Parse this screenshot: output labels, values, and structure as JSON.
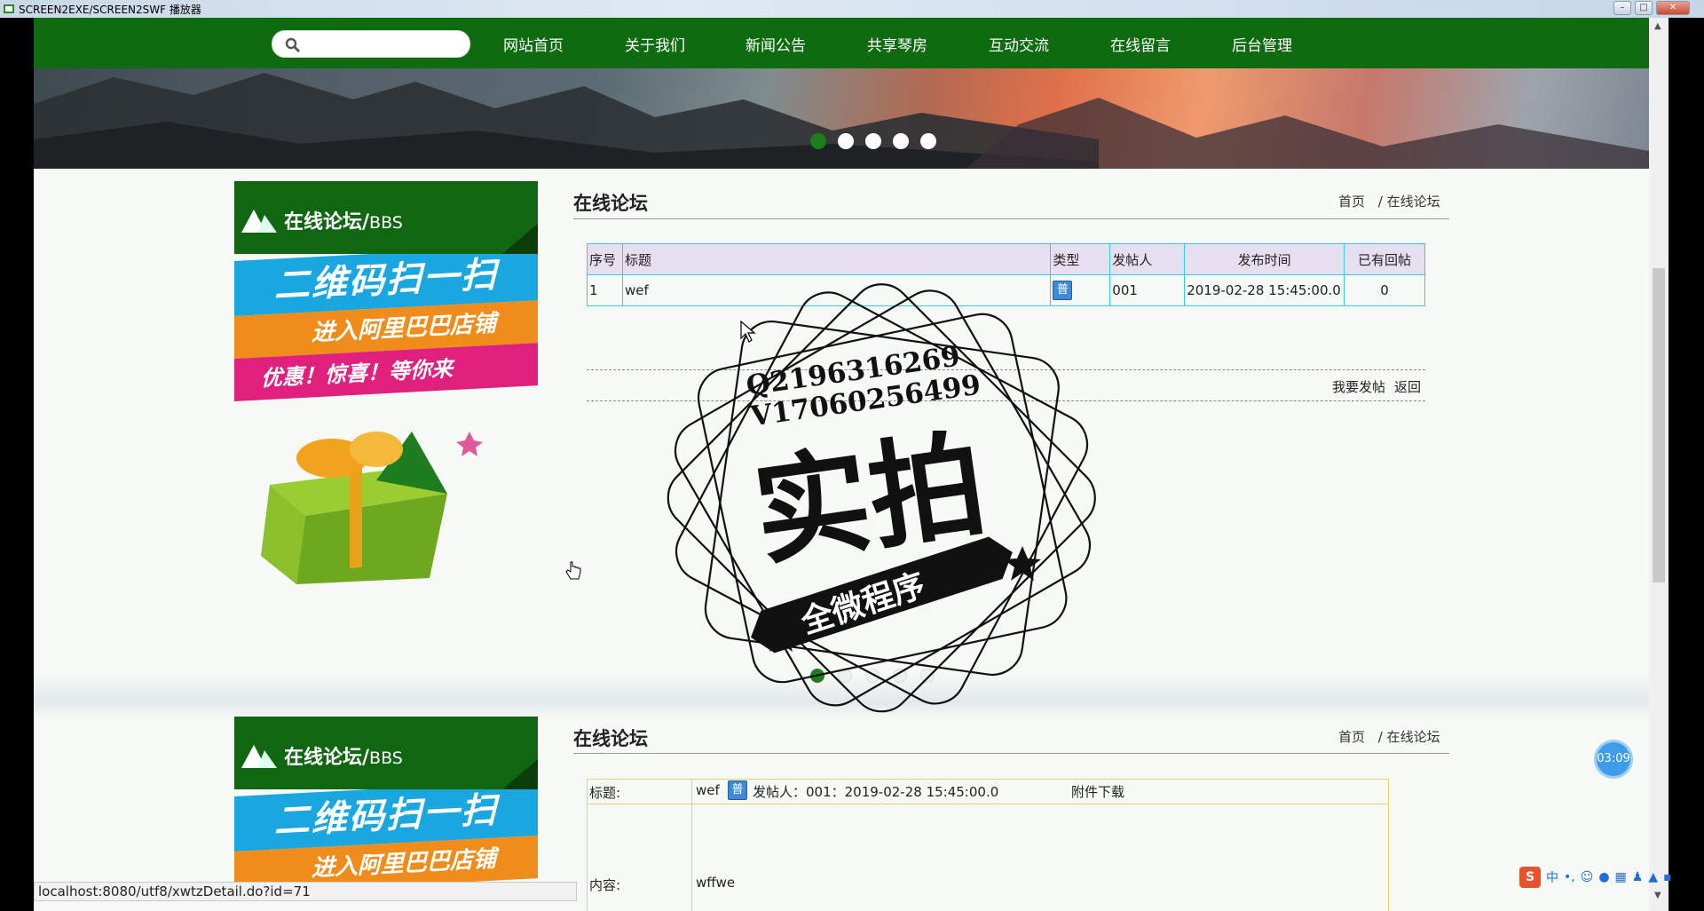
{
  "window": {
    "title": "SCREEN2EXE/SCREEN2SWF 播放器",
    "min": "–",
    "max": "□",
    "close": "✕"
  },
  "nav": {
    "search_placeholder": "",
    "items": [
      "网站首页",
      "关于我们",
      "新闻公告",
      "共享琴房",
      "互动交流",
      "在线留言",
      "后台管理"
    ]
  },
  "slider": {
    "dot_count": 5,
    "active_index": 0
  },
  "sidebar": {
    "title": "在线论坛/",
    "title_en": "BBS",
    "ad_line1": "二维码扫一扫",
    "ad_line2": "进入阿里巴巴店铺",
    "ad_line3": "优惠！惊喜！等你来"
  },
  "section1": {
    "title": "在线论坛",
    "crumb_home": "首页",
    "crumb_sep": "/",
    "crumb_current": "在线论坛",
    "table": {
      "headers": [
        "序号",
        "标题",
        "类型",
        "发帖人",
        "发布时间",
        "已有回帖"
      ],
      "rows": [
        {
          "index": "1",
          "title": "wef",
          "type": "普",
          "author": "001",
          "time": "2019-02-28 15:45:00.0",
          "replies": "0"
        }
      ]
    },
    "post_link": "我要发帖",
    "back_link": "返回"
  },
  "section2": {
    "title": "在线论坛",
    "crumb_home": "首页",
    "crumb_sep": "/",
    "crumb_current": "在线论坛",
    "detail": {
      "label_title": "标题:",
      "title_value": "wef",
      "type": "普",
      "author_text": "发帖人：001：2019-02-28 15:45:00.0",
      "attachment": "附件下载",
      "label_content": "内容:",
      "content_value": "wffwe"
    }
  },
  "watermark": {
    "line1": "Q2196316269",
    "line2": "V17060256499",
    "big": "实拍",
    "ribbon": "全微程序"
  },
  "statusbar": {
    "url": "localhost:8080/utf8/xwtzDetail.do?id=71"
  },
  "timer": "03:09",
  "ime": {
    "logo": "S",
    "mode": "中",
    "punct": "•,"
  },
  "colors": {
    "nav_green": "#0f6b0f",
    "table_border": "#2fcfdf",
    "header_bg": "#e6dff0"
  }
}
